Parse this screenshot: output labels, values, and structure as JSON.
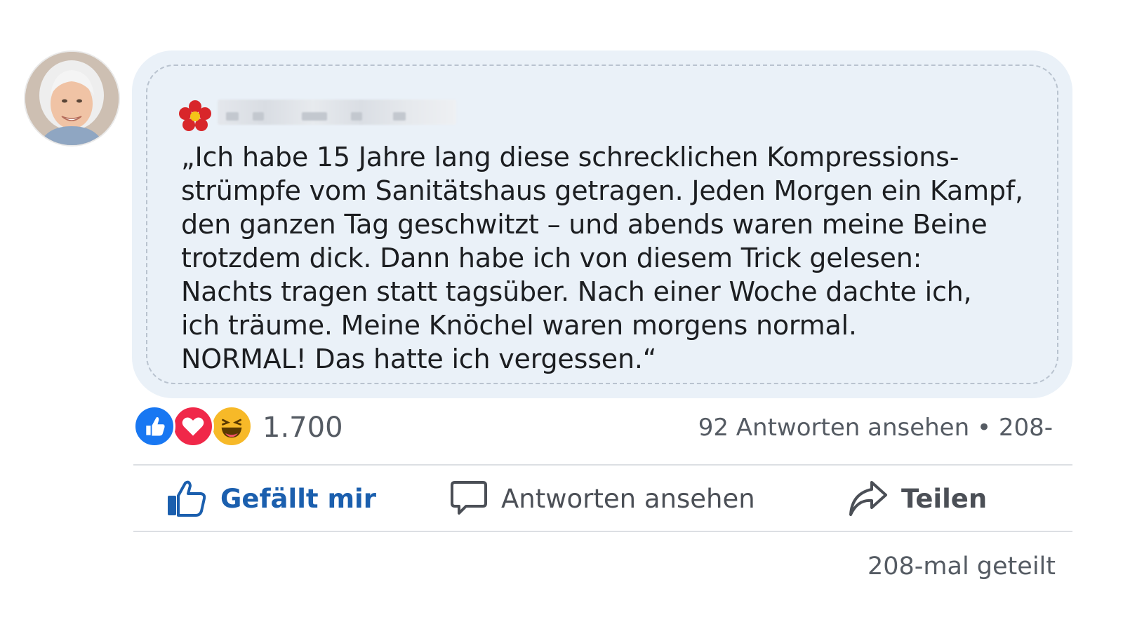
{
  "comment": {
    "author_avatar_icon": "avatar-photo",
    "author_badge_icon": "flower-icon",
    "text": "„Ich habe 15 Jahre lang diese schrecklichen Kompressions-\nstrümpfe vom Sanitätshaus getragen. Jeden Morgen ein Kampf,\nden ganzen Tag geschwitzt – und abends waren meine Beine\ntrotzdem dick. Dann habe ich von diesem Trick gelesen:\nNachts tragen statt tagsüber. Nach einer Woche dachte ich,\nich träume. Meine Knöchel waren morgens normal.\nNORMAL! Das hatte ich vergessen.“"
  },
  "reactions": {
    "icons": [
      "like-icon",
      "love-icon",
      "haha-icon"
    ],
    "count": "1.700"
  },
  "replies_info": "92 Antworten ansehen • 208-",
  "actions": {
    "like_label": "Gefällt mir",
    "reply_label": "Antworten ansehen",
    "share_label": "Teilen"
  },
  "share_count": "208-mal geteilt",
  "colors": {
    "bubble_bg": "#eaf1f8",
    "like_blue": "#1b5fae",
    "love_red": "#f02849",
    "haha_yellow": "#f7b928"
  }
}
